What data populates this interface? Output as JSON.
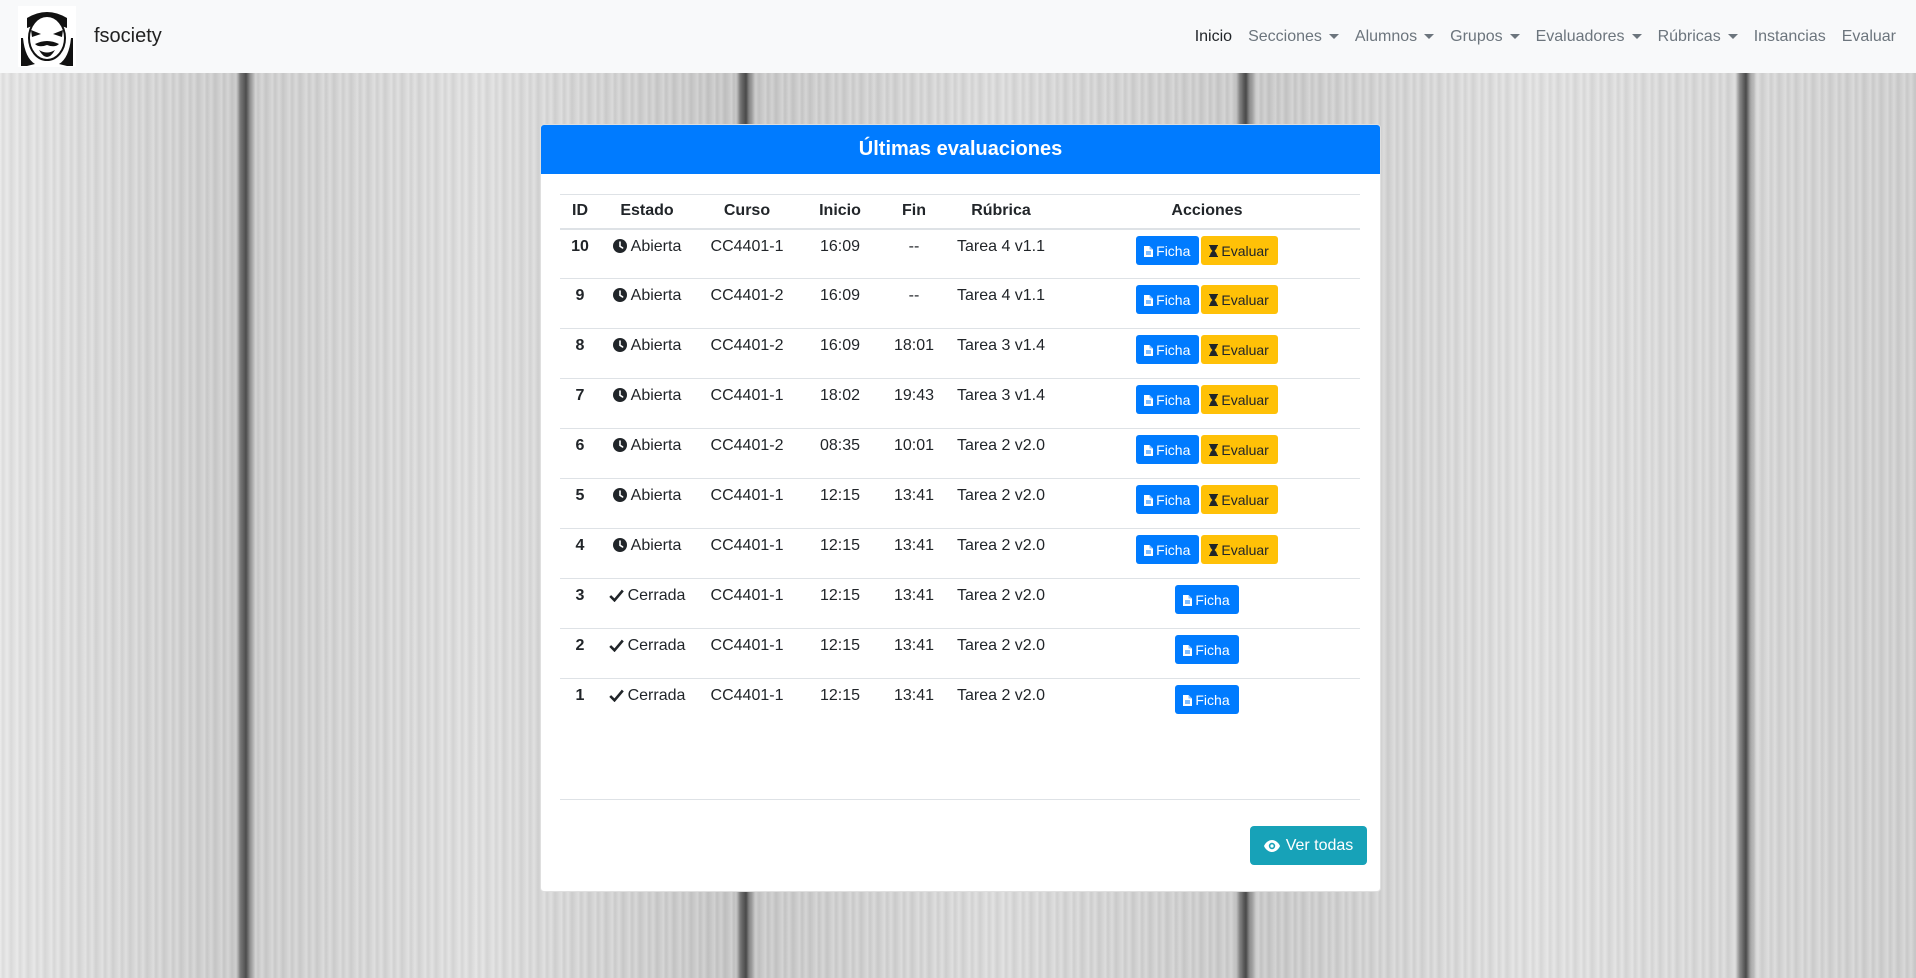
{
  "navbar": {
    "brand": "fsociety",
    "items": [
      {
        "label": "Inicio",
        "dropdown": false,
        "active": true
      },
      {
        "label": "Secciones",
        "dropdown": true,
        "active": false
      },
      {
        "label": "Alumnos",
        "dropdown": true,
        "active": false
      },
      {
        "label": "Grupos",
        "dropdown": true,
        "active": false
      },
      {
        "label": "Evaluadores",
        "dropdown": true,
        "active": false
      },
      {
        "label": "Rúbricas",
        "dropdown": true,
        "active": false
      },
      {
        "label": "Instancias",
        "dropdown": false,
        "active": false
      },
      {
        "label": "Evaluar",
        "dropdown": false,
        "active": false
      }
    ]
  },
  "card": {
    "title": "Últimas evaluaciones",
    "columns": [
      "ID",
      "Estado",
      "Curso",
      "Inicio",
      "Fin",
      "Rúbrica",
      "Acciones"
    ],
    "rows": [
      {
        "id": "10",
        "estado": "Abierta",
        "curso": "CC4401-1",
        "inicio": "16:09",
        "fin": "--",
        "rubrica": "Tarea 4 v1.1",
        "open": true
      },
      {
        "id": "9",
        "estado": "Abierta",
        "curso": "CC4401-2",
        "inicio": "16:09",
        "fin": "--",
        "rubrica": "Tarea 4 v1.1",
        "open": true
      },
      {
        "id": "8",
        "estado": "Abierta",
        "curso": "CC4401-2",
        "inicio": "16:09",
        "fin": "18:01",
        "rubrica": "Tarea 3 v1.4",
        "open": true
      },
      {
        "id": "7",
        "estado": "Abierta",
        "curso": "CC4401-1",
        "inicio": "18:02",
        "fin": "19:43",
        "rubrica": "Tarea 3 v1.4",
        "open": true
      },
      {
        "id": "6",
        "estado": "Abierta",
        "curso": "CC4401-2",
        "inicio": "08:35",
        "fin": "10:01",
        "rubrica": "Tarea 2 v2.0",
        "open": true
      },
      {
        "id": "5",
        "estado": "Abierta",
        "curso": "CC4401-1",
        "inicio": "12:15",
        "fin": "13:41",
        "rubrica": "Tarea 2 v2.0",
        "open": true
      },
      {
        "id": "4",
        "estado": "Abierta",
        "curso": "CC4401-1",
        "inicio": "12:15",
        "fin": "13:41",
        "rubrica": "Tarea 2 v2.0",
        "open": true
      },
      {
        "id": "3",
        "estado": "Cerrada",
        "curso": "CC4401-1",
        "inicio": "12:15",
        "fin": "13:41",
        "rubrica": "Tarea 2 v2.0",
        "open": false
      },
      {
        "id": "2",
        "estado": "Cerrada",
        "curso": "CC4401-1",
        "inicio": "12:15",
        "fin": "13:41",
        "rubrica": "Tarea 2 v2.0",
        "open": false
      },
      {
        "id": "1",
        "estado": "Cerrada",
        "curso": "CC4401-1",
        "inicio": "12:15",
        "fin": "13:41",
        "rubrica": "Tarea 2 v2.0",
        "open": false
      }
    ],
    "ficha_label": "Ficha",
    "evaluar_label": "Evaluar",
    "ver_todas_label": "Ver todas"
  },
  "colors": {
    "primary": "#007bff",
    "warning": "#ffc107",
    "info": "#17a2b8",
    "navbar_bg": "#f8f9fa"
  },
  "icons": {
    "open_state": "clock-icon",
    "closed_state": "check-icon",
    "ficha": "file-icon",
    "evaluar": "hourglass-icon",
    "ver_todas": "eye-icon"
  }
}
